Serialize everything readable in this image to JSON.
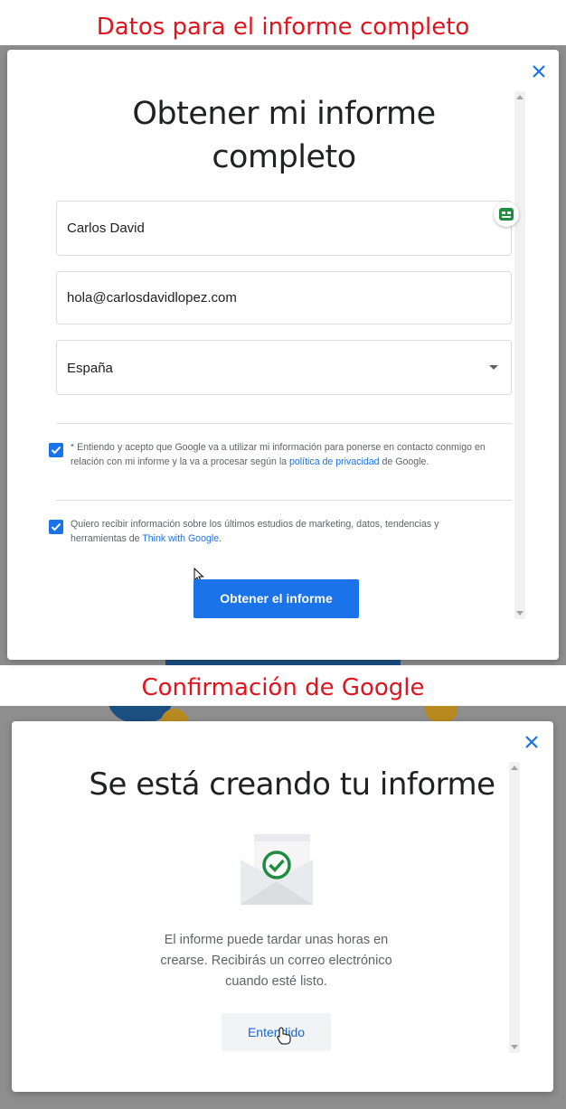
{
  "section1": {
    "caption": "Datos para el informe completo",
    "modal": {
      "title": "Obtener mi informe completo",
      "fields": {
        "name_value": "Carlos David",
        "email_value": "hola@carlosdavidlopez.com",
        "country_value": "España"
      },
      "consent": {
        "text_before": "* Entiendo y acepto que Google va a utilizar mi información para ponerse en contacto conmigo en relación con mi informe y la va a procesar según la ",
        "link": "política de privacidad",
        "text_after": " de Google."
      },
      "marketing": {
        "text_before": "Quiero recibir información sobre los últimos estudios de marketing, datos, tendencias y herramientas de ",
        "link": "Think with Google",
        "text_after": "."
      },
      "submit_label": "Obtener el informe"
    }
  },
  "section2": {
    "caption": "Confirmación de Google",
    "modal": {
      "title": "Se está creando tu informe",
      "message": "El informe puede tardar unas horas en crearse. Recibirás un correo electrónico cuando esté listo.",
      "button_label": "Entendido"
    }
  },
  "icons": [
    "close-icon",
    "password-manager-icon",
    "dropdown-arrow-icon",
    "checkbox-check-icon",
    "mouse-pointer-icon",
    "envelope-check-icon",
    "hand-cursor-icon"
  ],
  "colors": {
    "caption": "#e0141e",
    "primary": "#1a73e8",
    "link": "#1a73e8",
    "success_green": "#1e8e3e",
    "backdrop": "#8e8e8e"
  }
}
